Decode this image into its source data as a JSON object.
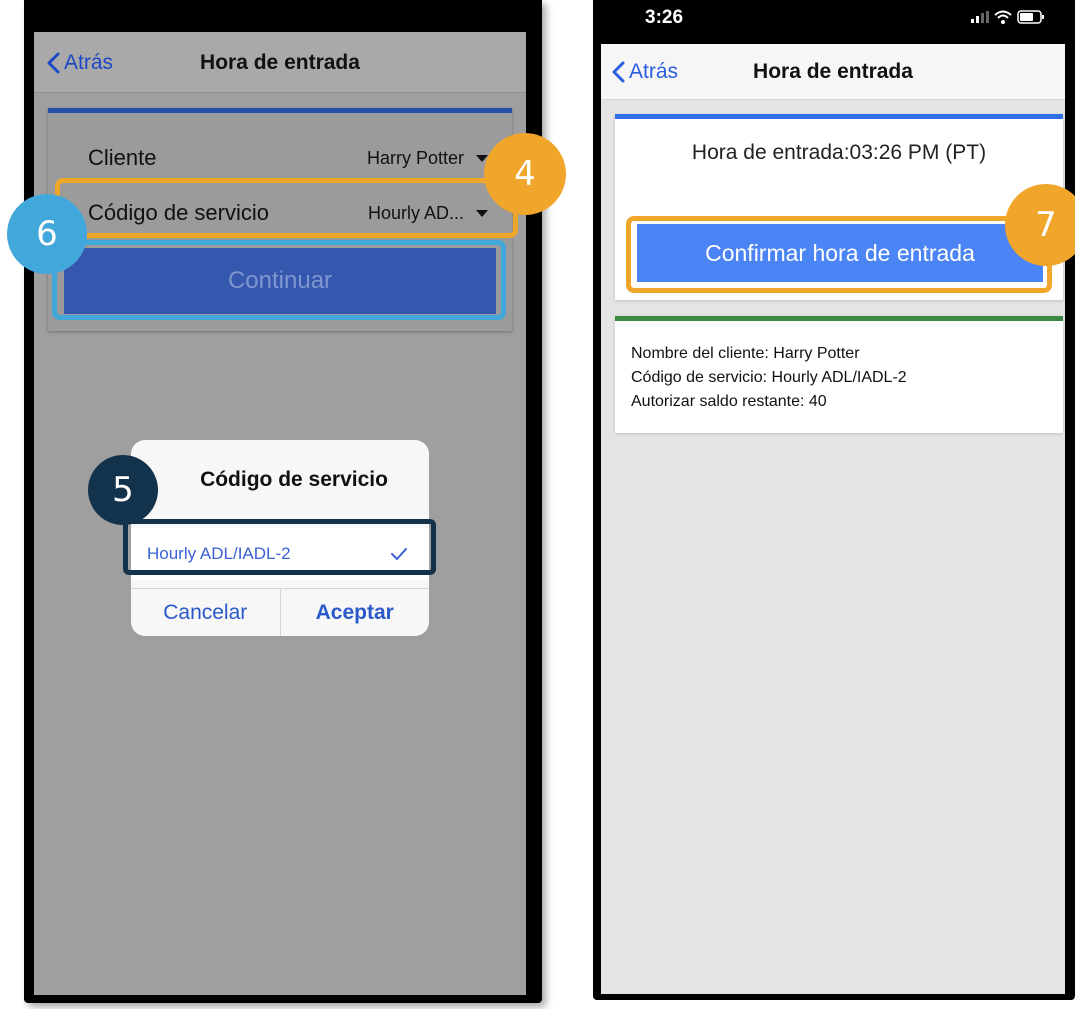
{
  "left_screen": {
    "nav": {
      "back_label": "Atrás",
      "title": "Hora de entrada"
    },
    "form": {
      "client_label": "Cliente",
      "client_value": "Harry Potter",
      "service_label": "Código de servicio",
      "service_value": "Hourly AD...",
      "continue_label": "Continuar"
    },
    "dialog": {
      "title": "Código de servicio",
      "option": "Hourly ADL/IADL-2",
      "option_selected": true,
      "cancel_label": "Cancelar",
      "accept_label": "Aceptar"
    }
  },
  "right_screen": {
    "status_bar": {
      "time": "3:26"
    },
    "nav": {
      "back_label": "Atrás",
      "title": "Hora de entrada"
    },
    "entry_time": "Hora de entrada:03:26 PM (PT)",
    "confirm_label": "Confirmar hora de entrada",
    "info": {
      "client_line": "Nombre del cliente: Harry Potter",
      "service_line": "Código de servicio: Hourly ADL/IADL-2",
      "balance_line": "Autorizar saldo restante: 40"
    }
  },
  "callouts": {
    "step_4": "4",
    "step_5": "5",
    "step_6": "6",
    "step_7": "7"
  },
  "colors": {
    "callout_orange": "#f0a52b",
    "callout_blue": "#42a7da",
    "callout_navy": "#13324c",
    "ios_blue": "#2b5fe0",
    "confirm_button": "#4b84f4",
    "card_accent_blue": "#2f70e8",
    "card_accent_green": "#3b8a43"
  }
}
